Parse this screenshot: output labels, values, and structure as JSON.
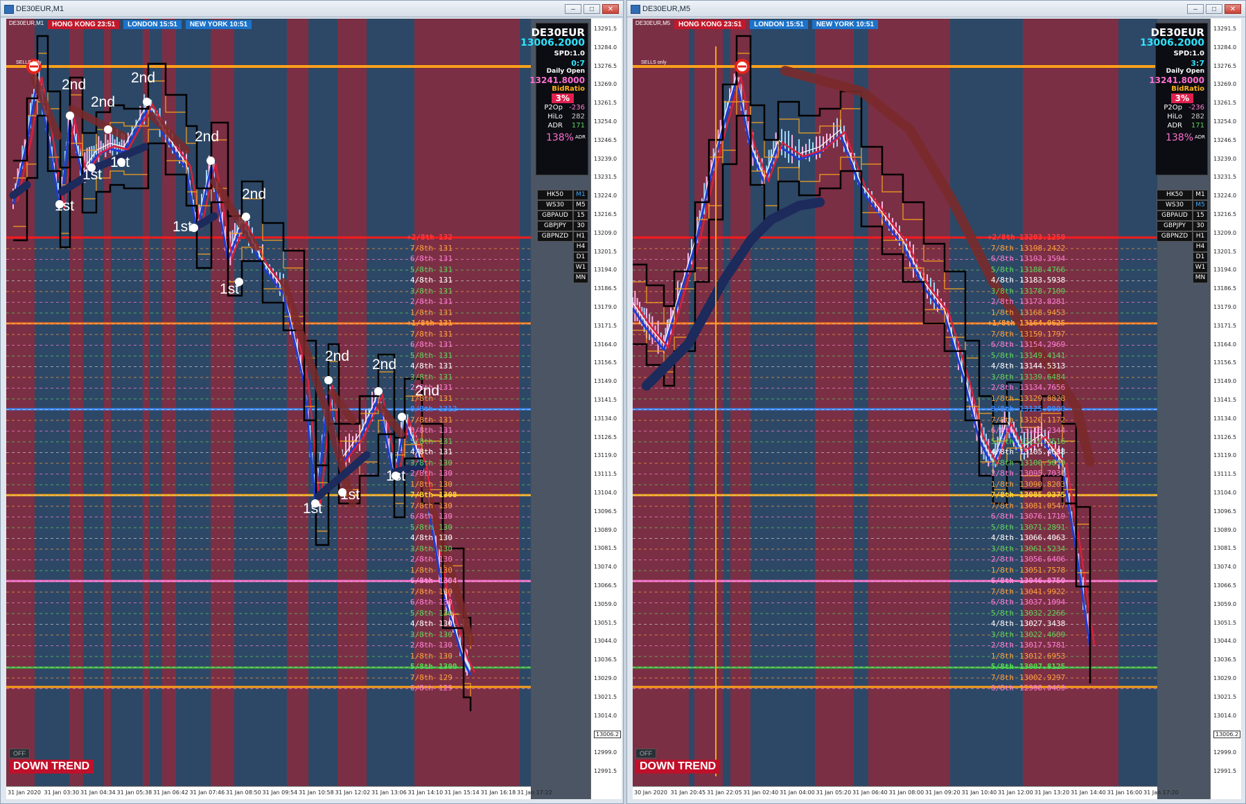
{
  "colors": {
    "bear": "#7b2f44",
    "bull": "#2d4866",
    "fast": "#1f3cd6",
    "slow": "#d8203d",
    "tail": "#7a2a2a",
    "tail_blue": "#1c2a5c",
    "channel": "#f6a11f",
    "red_line": "#ff1a1a",
    "orange_line": "#ff7a1a",
    "blue_line": "#3b8cff",
    "yellow_line": "#ffb21a",
    "pink_line": "#ff6fd0",
    "green_line": "#3cb53c"
  },
  "window1": {
    "title": "DE30EUR,M1",
    "symbol_label": "DE30EUR,M1",
    "sessions": {
      "hk": "HONG KONG 23:51",
      "ln": "LONDON  15:51",
      "ny": "NEW YORK  10:51"
    },
    "sells_only": "SELLS only",
    "info": {
      "symbol": "DE30EUR",
      "price": "13006.2000",
      "spd": "SPD:1.0",
      "timer": "0:7",
      "daily_open_label": "Daily Open",
      "daily_open": "13241.8000",
      "bid_ratio_label": "BidRatio",
      "bid_ratio": "3%",
      "p2op_label": "P2Op",
      "p2op": "-236",
      "hilo_label": "HiLo",
      "hilo": "282",
      "adr_label": "ADR",
      "adr": "171",
      "adr_pct": "138%",
      "adr_small": "ADR"
    },
    "symbols": [
      {
        "name": "HK50",
        "tf": "M1",
        "active": true
      },
      {
        "name": "WS30",
        "tf": "M5",
        "active": false
      },
      {
        "name": "GBPAUD",
        "tf": "15",
        "active": false
      },
      {
        "name": "GBPJPY",
        "tf": "30",
        "active": false
      },
      {
        "name": "GBPNZD",
        "tf": "H1",
        "active": false
      },
      {
        "name": "",
        "tf": "H4",
        "active": false
      },
      {
        "name": "",
        "tf": "D1",
        "active": false
      },
      {
        "name": "",
        "tf": "W1",
        "active": false
      },
      {
        "name": "",
        "tf": "MN",
        "active": false
      }
    ],
    "trend_label": "DOWN TREND",
    "off_label": "OFF",
    "price_ticks": [
      "13291.5",
      "13284.0",
      "13276.5",
      "13269.0",
      "13261.5",
      "13254.0",
      "13246.5",
      "13239.0",
      "13231.5",
      "13224.0",
      "13216.5",
      "13209.0",
      "13201.5",
      "13194.0",
      "13186.5",
      "13179.0",
      "13171.5",
      "13164.0",
      "13156.5",
      "13149.0",
      "13141.5",
      "13134.0",
      "13126.5",
      "13119.0",
      "13111.5",
      "13104.0",
      "13096.5",
      "13089.0",
      "13081.5",
      "13074.0",
      "13066.5",
      "13059.0",
      "13051.5",
      "13044.0",
      "13036.5",
      "13029.0",
      "13021.5",
      "13014.0",
      "13006.2",
      "12999.0",
      "12991.5"
    ],
    "time_ticks": [
      "31 Jan 2020",
      "31 Jan 03:30",
      "31 Jan 04:34",
      "31 Jan 05:38",
      "31 Jan 06:42",
      "31 Jan 07:46",
      "31 Jan 08:50",
      "31 Jan 09:54",
      "31 Jan 10:58",
      "31 Jan 12:02",
      "31 Jan 13:06",
      "31 Jan 14:10",
      "31 Jan 15:14",
      "31 Jan 16:18",
      "31 Jan 17:22"
    ],
    "levels": [
      {
        "frac": "+2/8th",
        "price": "132",
        "cls": "red"
      },
      {
        "frac": "7/8th",
        "price": "131",
        "cls": "orange"
      },
      {
        "frac": "6/8th",
        "price": "131",
        "cls": "pink"
      },
      {
        "frac": "5/8th",
        "price": "131",
        "cls": "green"
      },
      {
        "frac": "4/8th",
        "price": "131",
        "cls": "white"
      },
      {
        "frac": "3/8th",
        "price": "131",
        "cls": "green"
      },
      {
        "frac": "2/8th",
        "price": "131",
        "cls": "pink"
      },
      {
        "frac": "1/8th",
        "price": "131",
        "cls": "orange"
      },
      {
        "frac": "+1/8th",
        "price": "131",
        "cls": "orange"
      },
      {
        "frac": "7/8th",
        "price": "131",
        "cls": "orange"
      },
      {
        "frac": "6/8th",
        "price": "131",
        "cls": "pink"
      },
      {
        "frac": "5/8th",
        "price": "131",
        "cls": "green"
      },
      {
        "frac": "4/8th",
        "price": "131",
        "cls": "white"
      },
      {
        "frac": "3/8th",
        "price": "131",
        "cls": "green"
      },
      {
        "frac": "2/8th",
        "price": "131",
        "cls": "pink"
      },
      {
        "frac": "1/8th",
        "price": "131",
        "cls": "orange"
      },
      {
        "frac": "8/8th",
        "price": "1312",
        "cls": "blue"
      },
      {
        "frac": "7/8th",
        "price": "131",
        "cls": "orange"
      },
      {
        "frac": "6/8th",
        "price": "131",
        "cls": "pink"
      },
      {
        "frac": "5/8th",
        "price": "131",
        "cls": "green"
      },
      {
        "frac": "4/8th",
        "price": "131",
        "cls": "white"
      },
      {
        "frac": "3/8th",
        "price": "130",
        "cls": "green"
      },
      {
        "frac": "2/8th",
        "price": "130",
        "cls": "pink"
      },
      {
        "frac": "1/8th",
        "price": "130",
        "cls": "orange"
      },
      {
        "frac": "7/8th",
        "price": "1308",
        "cls": "yellow"
      },
      {
        "frac": "7/8th",
        "price": "130",
        "cls": "orange"
      },
      {
        "frac": "6/8th",
        "price": "130",
        "cls": "pink"
      },
      {
        "frac": "5/8th",
        "price": "130",
        "cls": "green"
      },
      {
        "frac": "4/8th",
        "price": "130",
        "cls": "white"
      },
      {
        "frac": "3/8th",
        "price": "130",
        "cls": "green"
      },
      {
        "frac": "2/8th",
        "price": "130",
        "cls": "pink"
      },
      {
        "frac": "1/8th",
        "price": "130",
        "cls": "orange"
      },
      {
        "frac": "6/8th",
        "price": "1304",
        "cls": "pinkbold"
      },
      {
        "frac": "7/8th",
        "price": "130",
        "cls": "orange"
      },
      {
        "frac": "6/8th",
        "price": "130",
        "cls": "pink"
      },
      {
        "frac": "5/8th",
        "price": "130",
        "cls": "green"
      },
      {
        "frac": "4/8th",
        "price": "130",
        "cls": "white"
      },
      {
        "frac": "3/8th",
        "price": "130",
        "cls": "green"
      },
      {
        "frac": "2/8th",
        "price": "130",
        "cls": "pink"
      },
      {
        "frac": "1/8th",
        "price": "130",
        "cls": "orange"
      },
      {
        "frac": "5/8th",
        "price": "1300",
        "cls": "greenbold"
      },
      {
        "frac": "7/8th",
        "price": "129",
        "cls": "orange"
      },
      {
        "frac": "6/8th",
        "price": "129",
        "cls": "pink"
      }
    ],
    "annotations": [
      {
        "text": "2nd"
      },
      {
        "text": "2nd"
      },
      {
        "text": "2nd"
      },
      {
        "text": "2nd"
      },
      {
        "text": "2nd"
      },
      {
        "text": "2nd"
      },
      {
        "text": "2nd"
      },
      {
        "text": "2nd"
      },
      {
        "text": "1st"
      },
      {
        "text": "1st"
      },
      {
        "text": "1st"
      },
      {
        "text": "1st"
      },
      {
        "text": "1st"
      },
      {
        "text": "1st"
      },
      {
        "text": "1st"
      },
      {
        "text": "1st"
      }
    ]
  },
  "window2": {
    "title": "DE30EUR,M5",
    "symbol_label": "DE30EUR,M5",
    "sessions": {
      "hk": "HONG KONG 23:51",
      "ln": "LONDON  15:51",
      "ny": "NEW YORK  10:51"
    },
    "sells_only": "SELLS only",
    "info": {
      "symbol": "DE30EUR",
      "price": "13006.2000",
      "spd": "SPD:1.0",
      "timer": "3:7",
      "daily_open_label": "Daily Open",
      "daily_open": "13241.8000",
      "bid_ratio_label": "BidRatio",
      "bid_ratio": "3%",
      "p2op_label": "P2Op",
      "p2op": "-236",
      "hilo_label": "HiLo",
      "hilo": "282",
      "adr_label": "ADR",
      "adr": "171",
      "adr_pct": "138%",
      "adr_small": "ADR"
    },
    "symbols": [
      {
        "name": "HK50",
        "tf": "M1",
        "active": false
      },
      {
        "name": "WS30",
        "tf": "M5",
        "active": true
      },
      {
        "name": "GBPAUD",
        "tf": "15",
        "active": false
      },
      {
        "name": "GBPJPY",
        "tf": "30",
        "active": false
      },
      {
        "name": "GBPNZD",
        "tf": "H1",
        "active": false
      },
      {
        "name": "",
        "tf": "H4",
        "active": false
      },
      {
        "name": "",
        "tf": "D1",
        "active": false
      },
      {
        "name": "",
        "tf": "W1",
        "active": false
      },
      {
        "name": "",
        "tf": "MN",
        "active": false
      }
    ],
    "trend_label": "DOWN TREND",
    "off_label": "OFF",
    "price_ticks": [
      "13291.5",
      "13284.0",
      "13276.5",
      "13269.0",
      "13261.5",
      "13254.0",
      "13246.5",
      "13239.0",
      "13231.5",
      "13224.0",
      "13216.5",
      "13209.0",
      "13201.5",
      "13194.0",
      "13186.5",
      "13179.0",
      "13171.5",
      "13164.0",
      "13156.5",
      "13149.0",
      "13141.5",
      "13134.0",
      "13126.5",
      "13119.0",
      "13111.5",
      "13104.0",
      "13096.5",
      "13089.0",
      "13081.5",
      "13074.0",
      "13066.5",
      "13059.0",
      "13051.5",
      "13044.0",
      "13036.5",
      "13029.0",
      "13021.5",
      "13014.0",
      "13006.2",
      "12999.0",
      "12991.5"
    ],
    "time_ticks": [
      "30 Jan 2020",
      "31 Jan 20:45",
      "31 Jan 22:05",
      "31 Jan 02:40",
      "31 Jan 04:00",
      "31 Jan 05:20",
      "31 Jan 06:40",
      "31 Jan 08:00",
      "31 Jan 09:20",
      "31 Jan 10:40",
      "31 Jan 12:00",
      "31 Jan 13:20",
      "31 Jan 14:40",
      "31 Jan 16:00",
      "31 Jan 17:20"
    ],
    "levels": [
      {
        "frac": "+2/8th",
        "price": "13203.1250",
        "cls": "red"
      },
      {
        "frac": "7/8th",
        "price": "13198.2422",
        "cls": "orange"
      },
      {
        "frac": "6/8th",
        "price": "13193.3594",
        "cls": "pink"
      },
      {
        "frac": "5/8th",
        "price": "13188.4766",
        "cls": "green"
      },
      {
        "frac": "4/8th",
        "price": "13183.5938",
        "cls": "white"
      },
      {
        "frac": "3/8th",
        "price": "13178.7109",
        "cls": "green"
      },
      {
        "frac": "2/8th",
        "price": "13173.8281",
        "cls": "pink"
      },
      {
        "frac": "1/8th",
        "price": "13168.9453",
        "cls": "orange"
      },
      {
        "frac": "+1/8th",
        "price": "13164.0625",
        "cls": "orange"
      },
      {
        "frac": "7/8th",
        "price": "13159.1797",
        "cls": "orange"
      },
      {
        "frac": "6/8th",
        "price": "13154.2969",
        "cls": "pink"
      },
      {
        "frac": "5/8th",
        "price": "13149.4141",
        "cls": "green"
      },
      {
        "frac": "4/8th",
        "price": "13144.5313",
        "cls": "white"
      },
      {
        "frac": "3/8th",
        "price": "13139.6484",
        "cls": "green"
      },
      {
        "frac": "2/8th",
        "price": "13134.7656",
        "cls": "pink"
      },
      {
        "frac": "1/8th",
        "price": "13129.8828",
        "cls": "orange"
      },
      {
        "frac": "8/8th",
        "price": "13125.0000",
        "cls": "blue"
      },
      {
        "frac": "7/8th",
        "price": "13120.1172",
        "cls": "orange"
      },
      {
        "frac": "6/8th",
        "price": "13115.2344",
        "cls": "pink"
      },
      {
        "frac": "5/8th",
        "price": "13110.3516",
        "cls": "green"
      },
      {
        "frac": "4/8th",
        "price": "13105.4688",
        "cls": "white"
      },
      {
        "frac": "3/8th",
        "price": "13100.5859",
        "cls": "green"
      },
      {
        "frac": "2/8th",
        "price": "13095.7031",
        "cls": "pink"
      },
      {
        "frac": "1/8th",
        "price": "13090.8203",
        "cls": "orange"
      },
      {
        "frac": "7/8th",
        "price": "13085.9375",
        "cls": "yellow"
      },
      {
        "frac": "7/8th",
        "price": "13081.0547",
        "cls": "orange"
      },
      {
        "frac": "6/8th",
        "price": "13076.1719",
        "cls": "pink"
      },
      {
        "frac": "5/8th",
        "price": "13071.2891",
        "cls": "green"
      },
      {
        "frac": "4/8th",
        "price": "13066.4063",
        "cls": "white"
      },
      {
        "frac": "3/8th",
        "price": "13061.5234",
        "cls": "green"
      },
      {
        "frac": "2/8th",
        "price": "13056.6406",
        "cls": "pink"
      },
      {
        "frac": "1/8th",
        "price": "13051.7578",
        "cls": "orange"
      },
      {
        "frac": "6/8th",
        "price": "13046.8750",
        "cls": "pinkbold"
      },
      {
        "frac": "7/8th",
        "price": "13041.9922",
        "cls": "orange"
      },
      {
        "frac": "6/8th",
        "price": "13037.1094",
        "cls": "pink"
      },
      {
        "frac": "5/8th",
        "price": "13032.2266",
        "cls": "green"
      },
      {
        "frac": "4/8th",
        "price": "13027.3438",
        "cls": "white"
      },
      {
        "frac": "3/8th",
        "price": "13022.4609",
        "cls": "green"
      },
      {
        "frac": "2/8th",
        "price": "13017.5781",
        "cls": "pink"
      },
      {
        "frac": "1/8th",
        "price": "13012.6953",
        "cls": "orange"
      },
      {
        "frac": "5/8th",
        "price": "13007.8125",
        "cls": "greenbold"
      },
      {
        "frac": "7/8th",
        "price": "13002.9297",
        "cls": "orange"
      },
      {
        "frac": "6/8th",
        "price": "12998.0469",
        "cls": "pink"
      }
    ]
  }
}
